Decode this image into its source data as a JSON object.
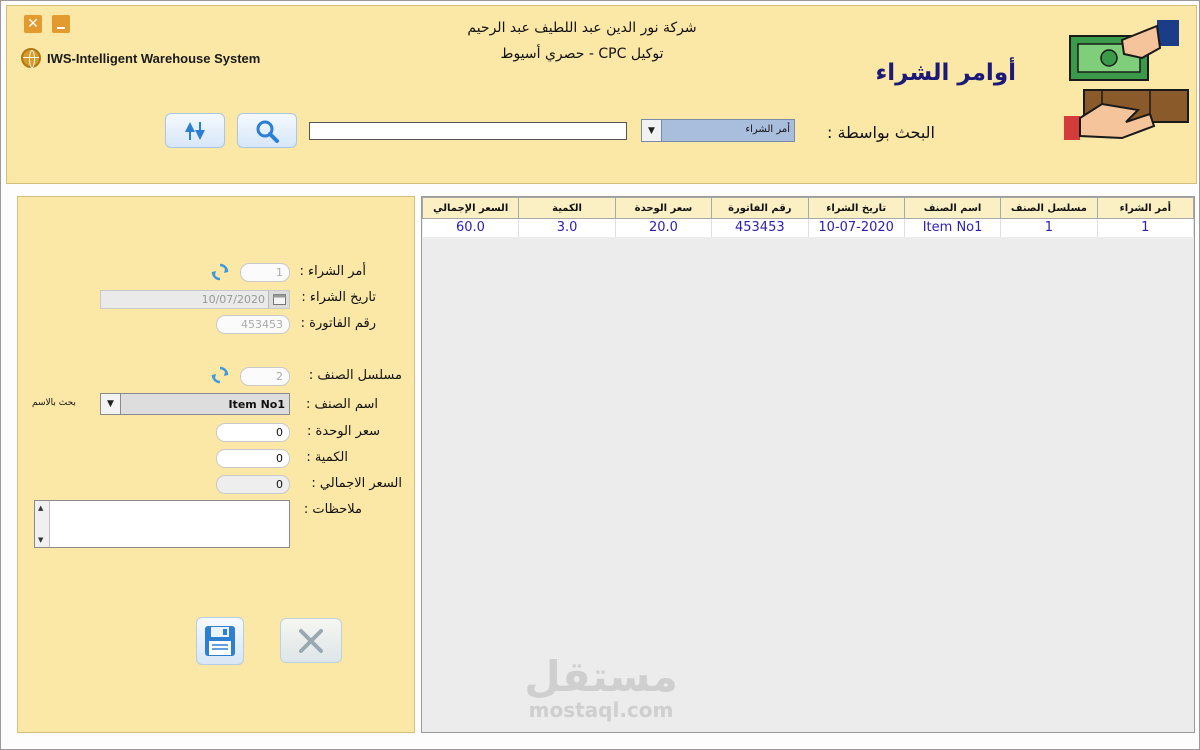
{
  "window": {
    "close_glyph": "✕",
    "system_name": "IWS-Intelligent Warehouse System"
  },
  "header": {
    "company_line1": "شركة نور الدين عبد اللطيف عبد الرحيم",
    "company_line2": "توكيل CPC - حصري أسيوط",
    "page_title": "أوامر الشراء"
  },
  "search": {
    "label": "البحث بواسطة :",
    "by_selected": "أمر الشراء",
    "query": ""
  },
  "grid": {
    "columns": [
      "أمر الشراء",
      "مسلسل الصنف",
      "اسم الصنف",
      "تاريخ الشراء",
      "رقم الفاتورة",
      "سعر الوحدة",
      "الكمية",
      "السعر الإجمالي"
    ],
    "rows": [
      [
        "1",
        "1",
        "Item No1",
        "10-07-2020",
        "453453",
        "20.0",
        "3.0",
        "60.0"
      ]
    ]
  },
  "form": {
    "po_label": "أمر الشراء :",
    "po_value": "1",
    "date_label": "تاريخ الشراء :",
    "date_value": "10/07/2020",
    "invoice_label": "رقم الفاتورة :",
    "invoice_value": "453453",
    "item_serial_label": "مسلسل الصنف :",
    "item_serial_value": "2",
    "item_name_label": "اسم الصنف :",
    "item_name_value": "Item No1",
    "search_by_name": "بحث بالاسم",
    "unit_price_label": "سعر الوحدة :",
    "unit_price_value": "0",
    "qty_label": "الكمية :",
    "qty_value": "0",
    "total_label": "السعر الاجمالي :",
    "total_value": "0",
    "notes_label": "ملاحظات :",
    "notes_value": ""
  },
  "watermark": {
    "arabic": "مستقل",
    "latin": "mostaql.com"
  },
  "colors": {
    "panel_bg": "#fbe8a6",
    "title_color": "#1c1a78",
    "grid_text": "#2b1fb0"
  }
}
